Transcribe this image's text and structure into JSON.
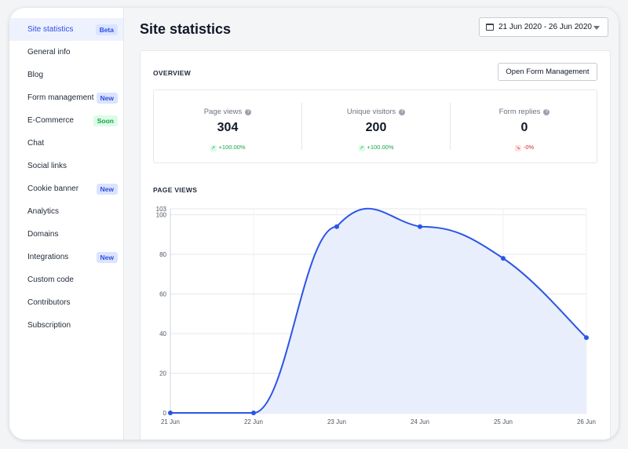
{
  "sidebar": {
    "items": [
      {
        "label": "Site statistics",
        "badge": "Beta",
        "badge_type": "beta",
        "active": true
      },
      {
        "label": "General info"
      },
      {
        "label": "Blog"
      },
      {
        "label": "Form management",
        "badge": "New",
        "badge_type": "new"
      },
      {
        "label": "E-Commerce",
        "badge": "Soon",
        "badge_type": "soon"
      },
      {
        "label": "Chat"
      },
      {
        "label": "Social links"
      },
      {
        "label": "Cookie banner",
        "badge": "New",
        "badge_type": "new"
      },
      {
        "label": "Analytics"
      },
      {
        "label": "Domains"
      },
      {
        "label": "Integrations",
        "badge": "New",
        "badge_type": "new"
      },
      {
        "label": "Custom code"
      },
      {
        "label": "Contributors"
      },
      {
        "label": "Subscription"
      }
    ]
  },
  "header": {
    "title": "Site statistics",
    "date_range": "21 Jun 2020 - 26 Jun 2020"
  },
  "overview": {
    "title": "OVERVIEW",
    "open_button": "Open Form Management",
    "stats": [
      {
        "label": "Page views",
        "value": "304",
        "change": "+100.00%",
        "direction": "up"
      },
      {
        "label": "Unique visitors",
        "value": "200",
        "change": "+100.00%",
        "direction": "up"
      },
      {
        "label": "Form replies",
        "value": "0",
        "change": "-0%",
        "direction": "down"
      }
    ]
  },
  "page_views": {
    "title": "PAGE VIEWS"
  },
  "colors": {
    "accent": "#2f4fe0",
    "line": "#2b55e6",
    "area": "#e9eefd",
    "up": "#16a34a",
    "down": "#dc2626"
  },
  "icons": {
    "date": "calendar-icon",
    "dropdown": "chevron-down-icon",
    "help": "question-circle-icon",
    "up": "arrow-up-right-icon",
    "down": "arrow-down-right-icon"
  },
  "chart_data": {
    "type": "area",
    "categories": [
      "21 Jun",
      "22 Jun",
      "23 Jun",
      "24 Jun",
      "25 Jun",
      "26 Jun"
    ],
    "series": [
      {
        "values": [
          0,
          0,
          94,
          94,
          78,
          38
        ]
      }
    ],
    "yticks": [
      0,
      20,
      40,
      60,
      80,
      100,
      103
    ],
    "ylim": [
      0,
      103
    ],
    "grid": true,
    "legend": "none"
  }
}
